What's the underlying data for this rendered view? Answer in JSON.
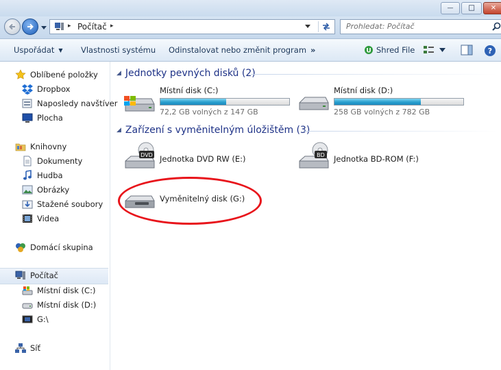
{
  "window": {
    "minimize_glyph": "—",
    "maximize_glyph": "☐",
    "close_glyph": "✕"
  },
  "address": {
    "crumb": "Počítač",
    "separator": "▸",
    "search_placeholder": "Prohledat: Počítač"
  },
  "toolbar": {
    "organize": "Uspořádat",
    "system_properties": "Vlastnosti systému",
    "uninstall": "Odinstalovat nebo změnit program",
    "more": "»",
    "shred": "Shred File"
  },
  "sidebar": {
    "favorites": "Oblíbené položky",
    "dropbox": "Dropbox",
    "recent": "Naposledy navštíver",
    "desktop": "Plocha",
    "libraries": "Knihovny",
    "documents": "Dokumenty",
    "music": "Hudba",
    "pictures": "Obrázky",
    "downloads": "Stažené soubory",
    "videos": "Videa",
    "homegroup": "Domácí skupina",
    "computer": "Počítač",
    "disk_c": "Místní disk (C:)",
    "disk_d": "Místní disk (D:)",
    "drive_g": "G:\\",
    "network": "Síť"
  },
  "groups": {
    "hdd": "Jednotky pevných disků (2)",
    "removable": "Zařízení s vyměnitelným úložištěm (3)"
  },
  "drives": {
    "c": {
      "name": "Místní disk (C:)",
      "free": "72,2 GB volných z 147 GB",
      "used_fraction": 0.51
    },
    "d": {
      "name": "Místní disk (D:)",
      "free": "258 GB volných z 782 GB",
      "used_fraction": 0.67
    },
    "e": {
      "name": "Jednotka DVD RW (E:)",
      "badge": "DVD"
    },
    "f": {
      "name": "Jednotka BD-ROM (F:)",
      "badge": "BD"
    },
    "g": {
      "name": "Vyměnitelný disk (G:)"
    }
  },
  "colors": {
    "highlight_circle": "#e8141b",
    "group_header": "#1e3287",
    "capacity_fill": "#2a9fce"
  }
}
